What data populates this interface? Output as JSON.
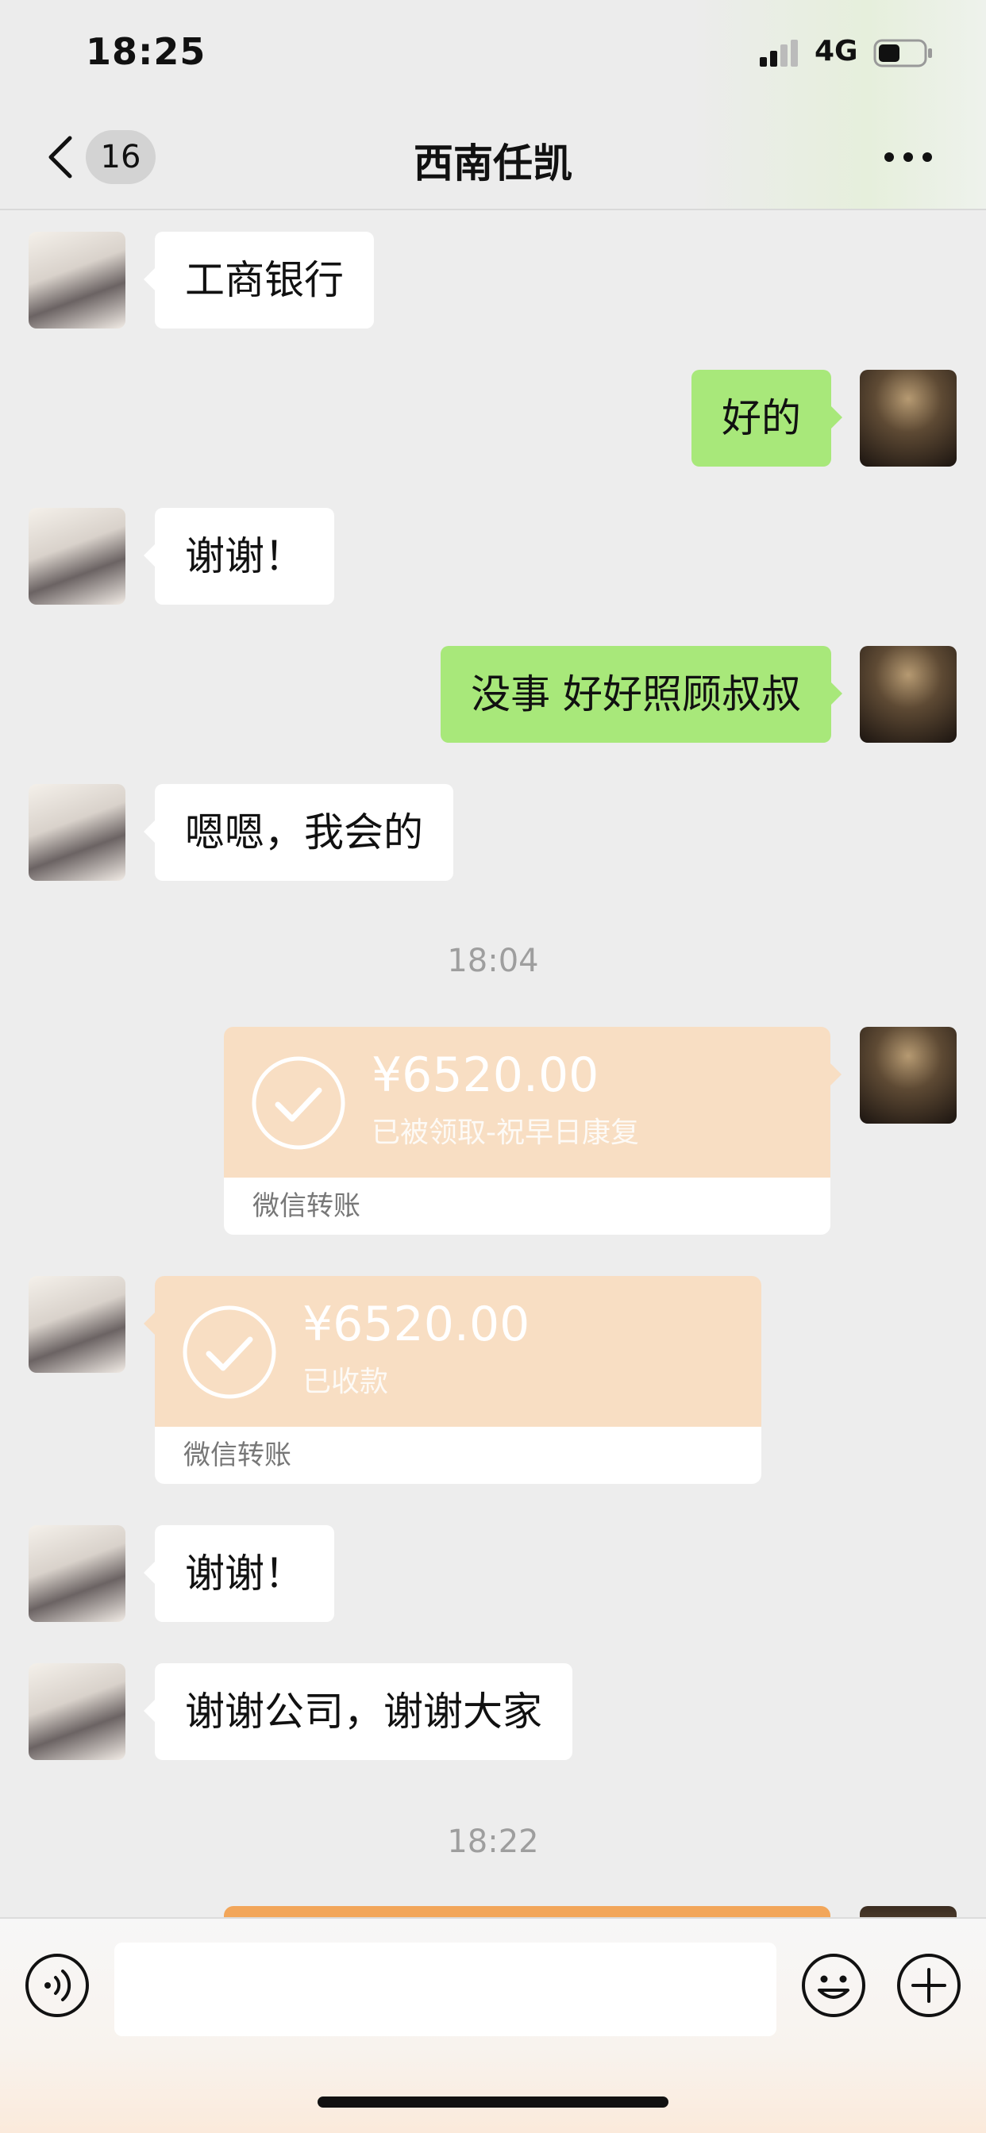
{
  "status_bar": {
    "time": "18:25",
    "network": "4G"
  },
  "nav": {
    "badge_count": "16",
    "title": "西南任凯"
  },
  "messages": [
    {
      "side": "in",
      "text": "工商银行"
    },
    {
      "side": "out",
      "text": "好的"
    },
    {
      "side": "in",
      "text": "谢谢！"
    },
    {
      "side": "out",
      "text": "没事 好好照顾叔叔"
    },
    {
      "side": "in",
      "text": "嗯嗯，我会的"
    },
    {
      "timestamp": "18:04"
    },
    {
      "side": "out",
      "transfer": {
        "amount": "¥6520.00",
        "note": "已被领取-祝早日康复",
        "label": "微信转账"
      }
    },
    {
      "side": "in",
      "transfer": {
        "amount": "¥6520.00",
        "note": "已收款",
        "label": "微信转账"
      }
    },
    {
      "side": "in",
      "text": "谢谢！"
    },
    {
      "side": "in",
      "text": "谢谢公司，谢谢大家"
    },
    {
      "timestamp": "18:22"
    }
  ],
  "input_bar": {
    "placeholder": ""
  },
  "colors": {
    "outgoing_bubble": "#a8e87a",
    "incoming_bubble": "#ffffff",
    "transfer_card": "#f8dec3",
    "pending_transfer": "#f2a65a",
    "background": "#ededed"
  },
  "icons": {
    "back": "chevron-left-icon",
    "more": "more-dots-icon",
    "voice": "voice-icon",
    "emoji": "emoji-icon",
    "plus": "plus-icon",
    "check": "check-circle-icon"
  }
}
